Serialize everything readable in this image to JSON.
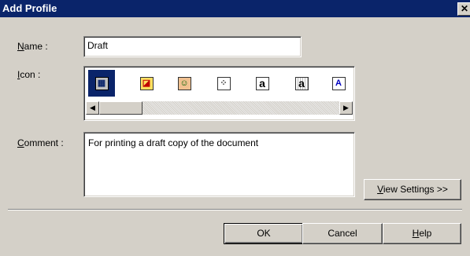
{
  "window": {
    "title": "Add Profile",
    "close_glyph": "✕"
  },
  "name": {
    "label_prefix": "",
    "label_accel": "N",
    "label_rest": "ame :",
    "value": "Draft"
  },
  "icon": {
    "label_accel": "I",
    "label_rest": "con :",
    "items": [
      {
        "name": "grid-document-icon",
        "glyph": "▦",
        "selected": true
      },
      {
        "name": "color-picture-icon",
        "glyph": "◪",
        "selected": false
      },
      {
        "name": "portrait-icon",
        "glyph": "☺",
        "selected": false
      },
      {
        "name": "dotted-document-icon",
        "glyph": "⁘",
        "selected": false
      },
      {
        "name": "letter-a-icon",
        "glyph": "a",
        "selected": false
      },
      {
        "name": "letter-a-shading-icon",
        "glyph": "a",
        "selected": false
      },
      {
        "name": "letter-a-blue-icon",
        "glyph": "A",
        "selected": false
      }
    ],
    "scroll_left": "◀",
    "scroll_right": "▶"
  },
  "comment": {
    "label_accel": "C",
    "label_rest": "omment :",
    "value": "For printing a draft copy of the document"
  },
  "buttons": {
    "view_settings_accel": "V",
    "view_settings_rest": "iew Settings >>",
    "ok": "OK",
    "cancel": "Cancel",
    "help_accel": "H",
    "help_rest": "elp"
  }
}
